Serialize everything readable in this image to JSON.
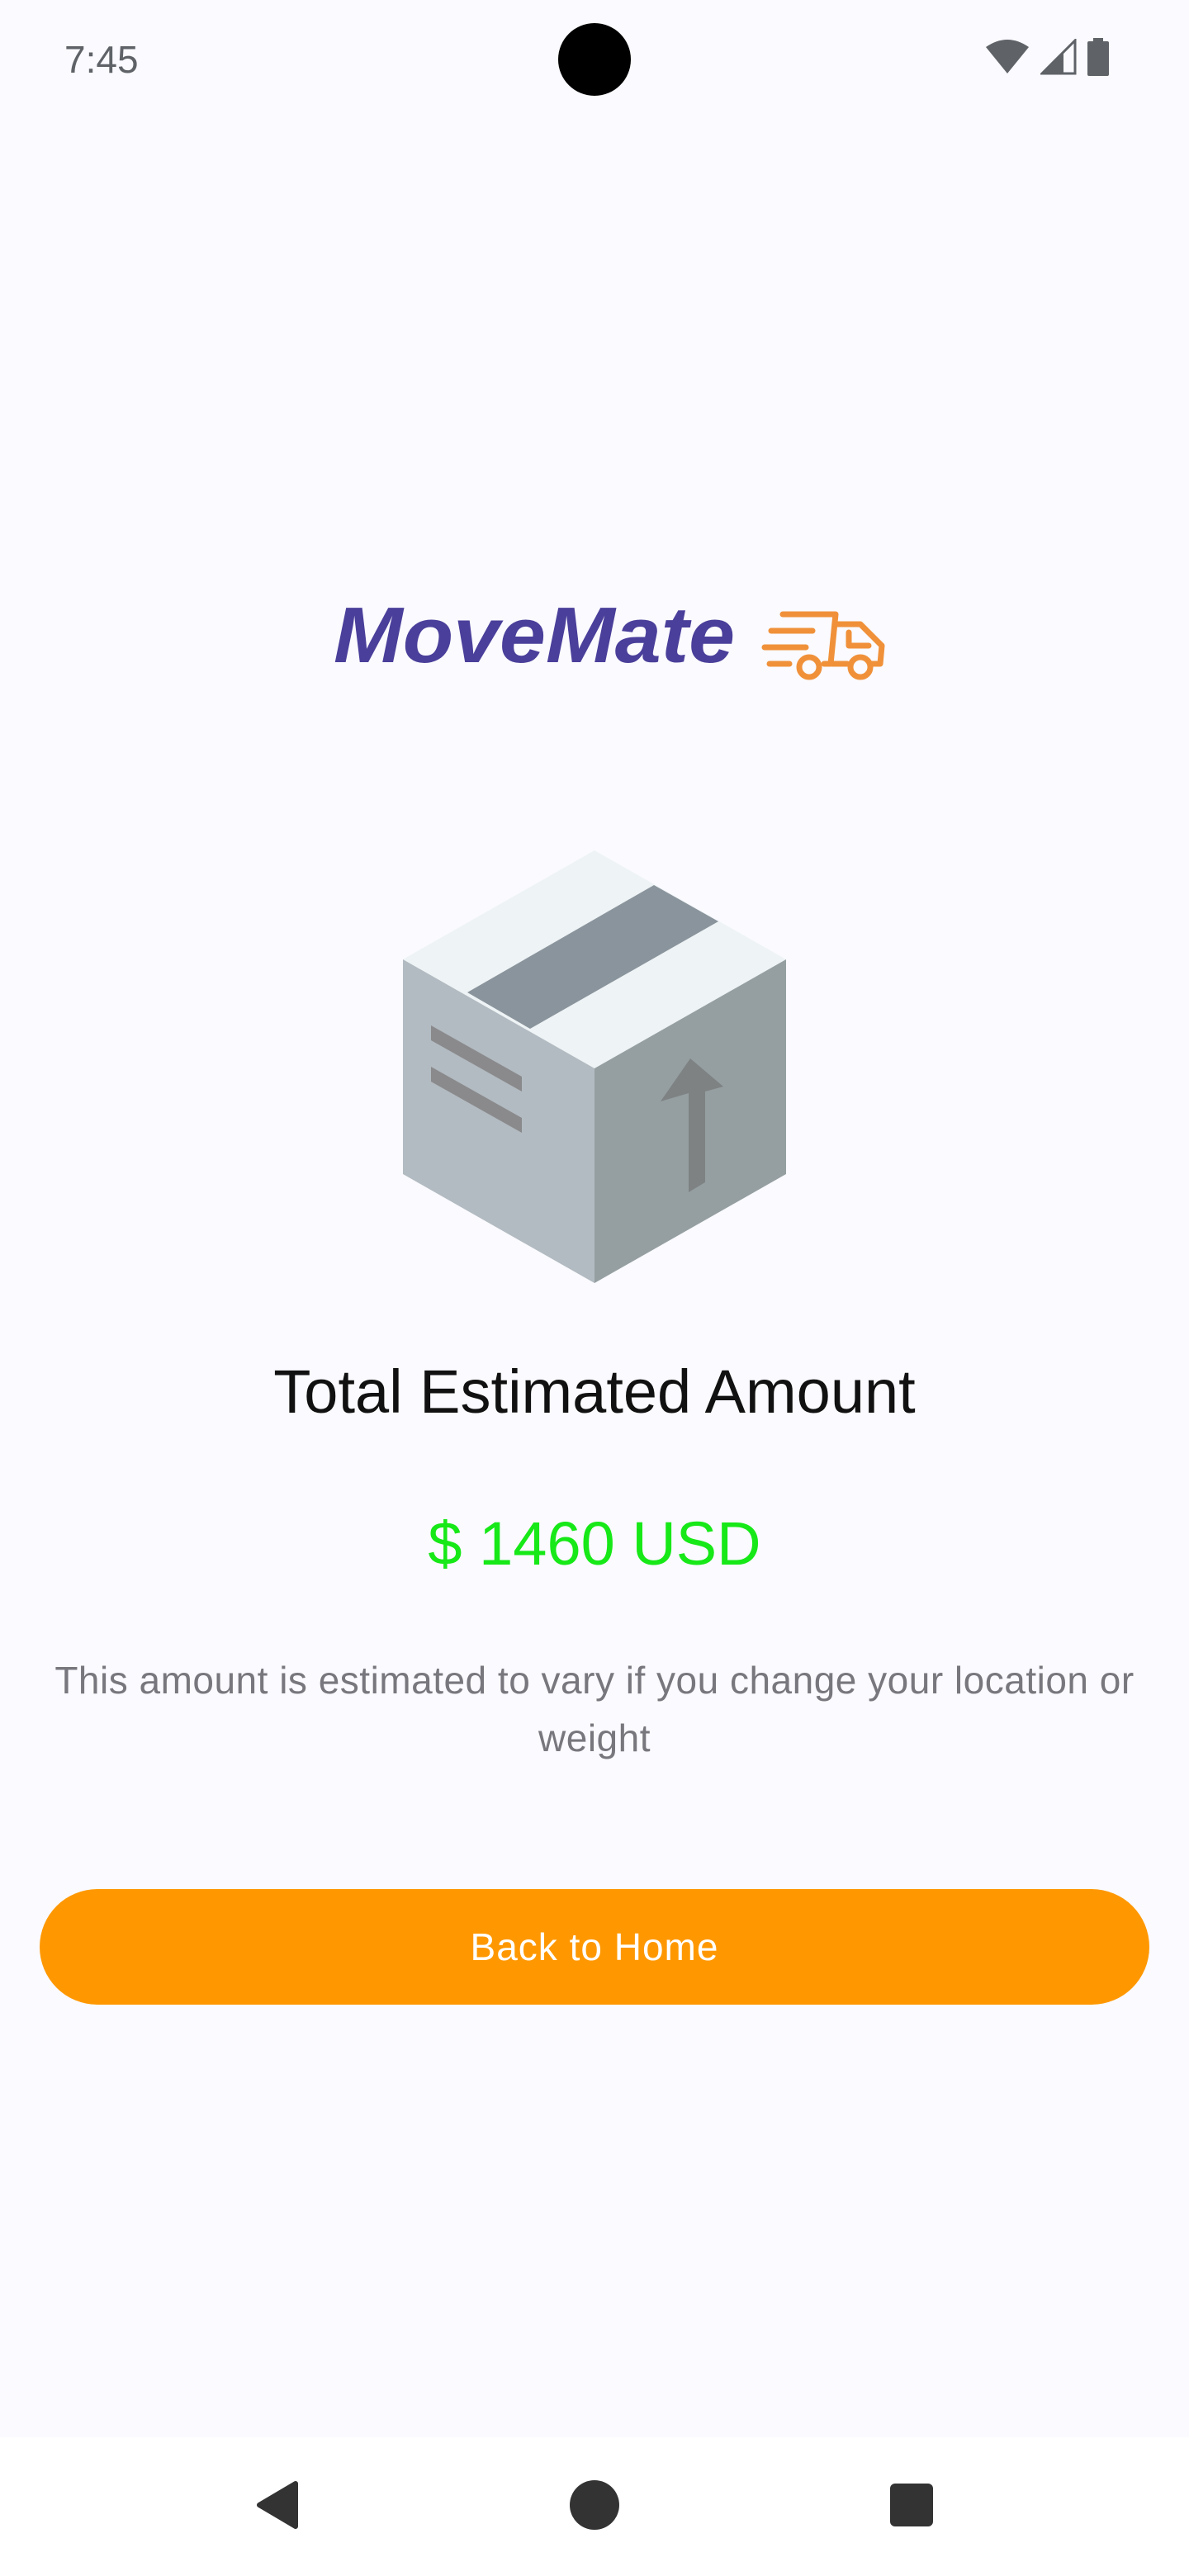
{
  "status_bar": {
    "time": "7:45",
    "icons": [
      "wifi-icon",
      "cellular-signal-icon",
      "battery-icon"
    ]
  },
  "logo": {
    "text": "MoveMate",
    "icon": "delivery-truck-icon",
    "text_color": "#4a3f9a",
    "icon_color": "#f0913a"
  },
  "illustration": {
    "icon": "package-box-icon"
  },
  "summary": {
    "title": "Total Estimated Amount",
    "amount": "$ 1460 USD",
    "note": "This amount is estimated to vary if you change your location or weight"
  },
  "actions": {
    "back_home_label": "Back to Home"
  },
  "nav_bar": {
    "items": [
      "back-icon",
      "home-icon",
      "recents-icon"
    ]
  },
  "colors": {
    "background": "#fafaff",
    "accent": "#ff9800",
    "amount": "#17e817",
    "note_text": "#77777d"
  }
}
